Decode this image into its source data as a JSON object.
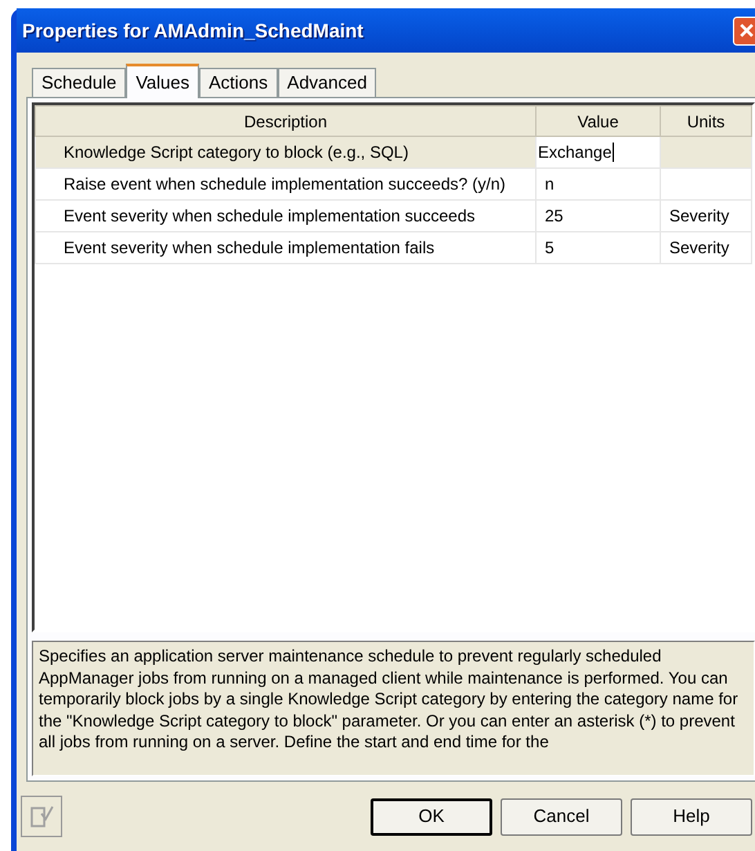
{
  "window": {
    "title": "Properties for AMAdmin_SchedMaint"
  },
  "tabs": [
    {
      "label": "Schedule",
      "selected": false
    },
    {
      "label": "Values",
      "selected": true
    },
    {
      "label": "Actions",
      "selected": false
    },
    {
      "label": "Advanced",
      "selected": false
    }
  ],
  "table": {
    "columns": [
      "Description",
      "Value",
      "Units"
    ],
    "rows": [
      {
        "description": "Knowledge Script category to block (e.g., SQL)",
        "value": "Exchange",
        "units": "",
        "selected": true,
        "editing": true
      },
      {
        "description": "Raise event when schedule implementation succeeds? (y/n)",
        "value": "n",
        "units": "",
        "selected": false,
        "editing": false
      },
      {
        "description": "Event severity when schedule implementation succeeds",
        "value": "25",
        "units": "Severity",
        "selected": false,
        "editing": false
      },
      {
        "description": "Event severity when schedule implementation fails",
        "value": "5",
        "units": "Severity",
        "selected": false,
        "editing": false
      }
    ]
  },
  "help_text": "Specifies an application server maintenance schedule to prevent regularly scheduled AppManager jobs from running on a managed client while maintenance is performed. You can temporarily block jobs by a single Knowledge Script category by entering the category name for the \"Knowledge Script category to block\" parameter. Or you can enter an asterisk (*) to prevent all jobs from running on a server. Define the start and end time for the",
  "buttons": [
    {
      "label": "OK",
      "default": true
    },
    {
      "label": "Cancel",
      "default": false
    },
    {
      "label": "Help",
      "default": false
    }
  ]
}
